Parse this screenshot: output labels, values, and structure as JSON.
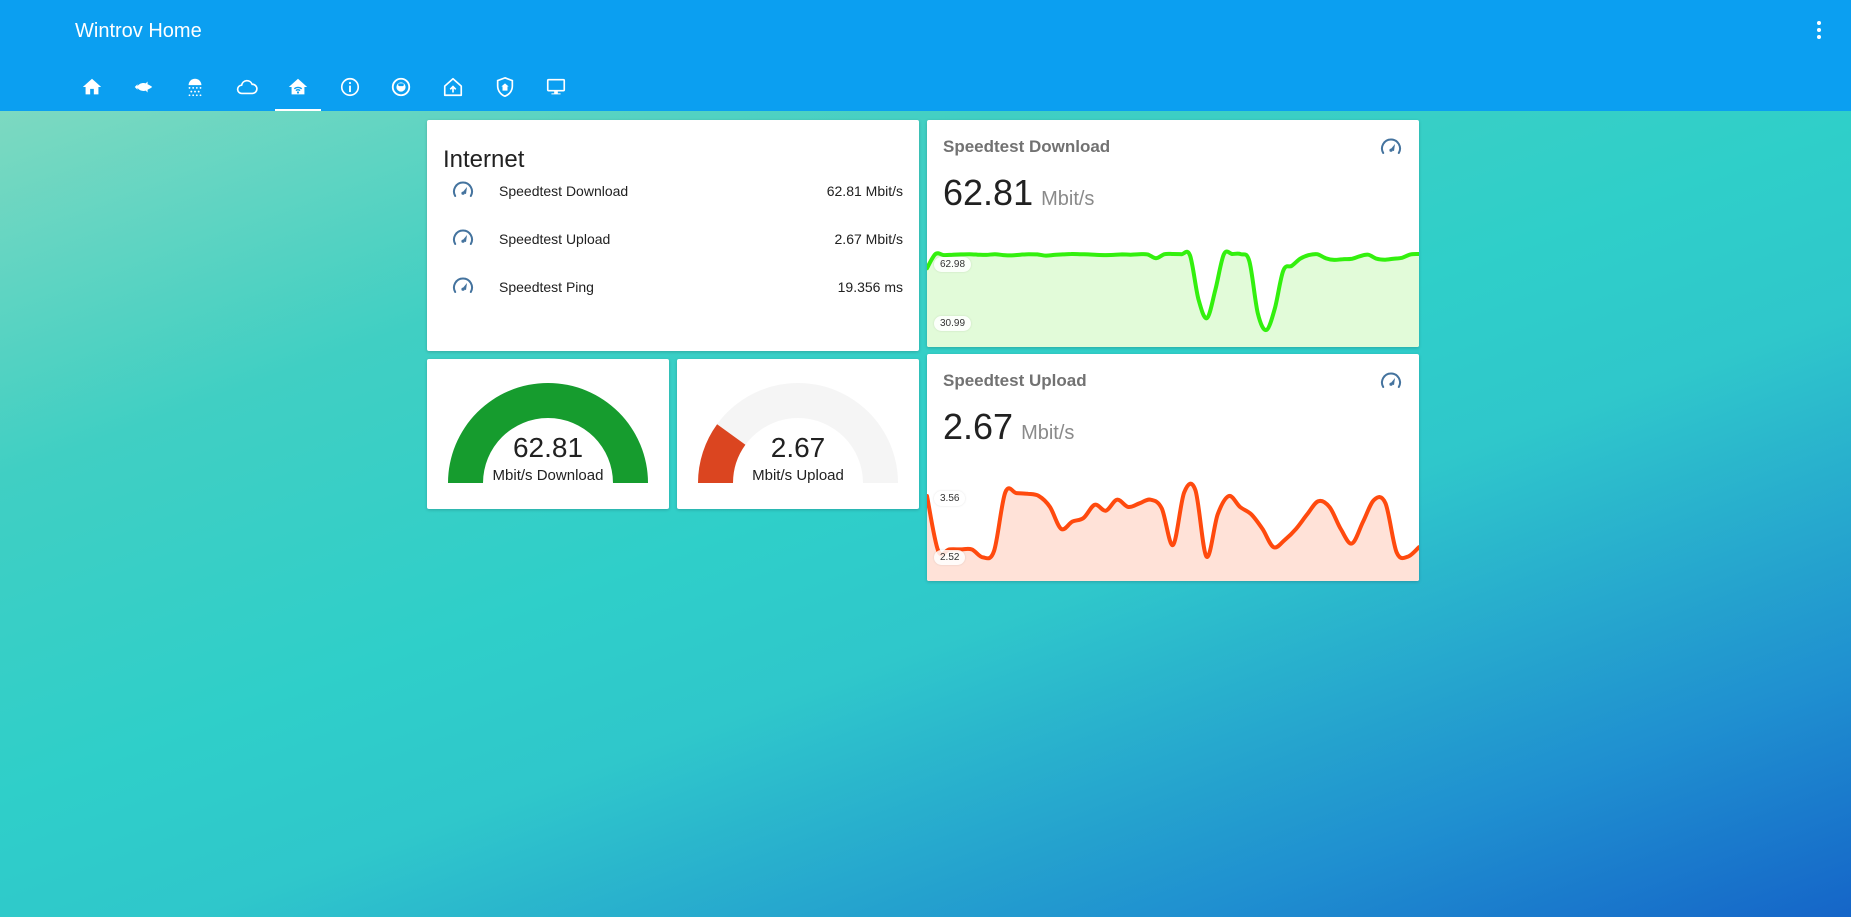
{
  "header": {
    "title": "Wintrov Home",
    "menu_icon": "dots-vertical-icon",
    "tabs": [
      {
        "icon": "home-icon",
        "active": false
      },
      {
        "icon": "fish-icon",
        "active": false
      },
      {
        "icon": "shower-icon",
        "active": false
      },
      {
        "icon": "cloud-icon",
        "active": false
      },
      {
        "icon": "home-wifi-icon",
        "active": true
      },
      {
        "icon": "info-icon",
        "active": false
      },
      {
        "icon": "robot-vacuum-icon",
        "active": false
      },
      {
        "icon": "home-import-icon",
        "active": false
      },
      {
        "icon": "shield-home-icon",
        "active": false
      },
      {
        "icon": "monitor-icon",
        "active": false
      }
    ],
    "colors": {
      "bar": "#0b9ff1",
      "text": "#ffffff"
    }
  },
  "internet_card": {
    "title": "Internet",
    "rows": [
      {
        "icon": "speedometer-icon",
        "name": "Speedtest Download",
        "value": "62.81 Mbit/s"
      },
      {
        "icon": "speedometer-icon",
        "name": "Speedtest Upload",
        "value": "2.67 Mbit/s"
      },
      {
        "icon": "speedometer-icon",
        "name": "Speedtest Ping",
        "value": "19.356 ms"
      }
    ]
  },
  "gauges": [
    {
      "value": "62.81",
      "label": "Mbit/s Download",
      "fraction": 1.0,
      "color": "#169c2e"
    },
    {
      "value": "2.67",
      "label": "Mbit/s Upload",
      "fraction": 0.2,
      "color": "#db4520"
    }
  ],
  "sensors": [
    {
      "name": "Speedtest Download",
      "icon": "speedometer-icon",
      "value": "62.81",
      "unit": "Mbit/s",
      "graph_max_label": "62.98",
      "graph_min_label": "30.99",
      "line_color": "#33f00e",
      "fill_color": "#e2fbd9",
      "min": 30.99,
      "max": 62.98,
      "points": [
        57,
        62.98,
        62.5,
        62.7,
        62.8,
        62.9,
        62.7,
        62.6,
        62.9,
        62.5,
        62.4,
        62.7,
        62.9,
        62.8,
        62.3,
        62.6,
        62.8,
        63,
        62.9,
        62.8,
        62.6,
        62.5,
        62.6,
        62.8,
        62.7,
        62.9,
        62.8,
        61.2,
        62.9,
        63,
        62.9,
        62.4,
        44,
        36,
        48,
        62.9,
        63,
        62.9,
        60,
        38,
        31,
        40,
        56,
        58,
        61,
        62.5,
        62.9,
        61.2,
        60.5,
        60.8,
        60.9,
        62,
        62.7,
        61,
        60.6,
        61,
        61.4,
        62.8,
        63
      ]
    },
    {
      "name": "Speedtest Upload",
      "icon": "speedometer-icon",
      "value": "2.67",
      "unit": "Mbit/s",
      "graph_max_label": "3.56",
      "graph_min_label": "2.52",
      "line_color": "#ff4a0e",
      "fill_color": "#ffe2d8",
      "min": 2.52,
      "max": 3.56,
      "points": [
        3.45,
        2.7,
        2.72,
        2.72,
        2.72,
        2.61,
        2.7,
        3.5,
        3.49,
        3.48,
        3.45,
        3.3,
        3.0,
        3.1,
        3.15,
        3.33,
        3.25,
        3.4,
        3.3,
        3.35,
        3.4,
        3.28,
        2.78,
        3.5,
        3.53,
        2.62,
        3.2,
        3.45,
        3.3,
        3.2,
        3.0,
        2.75,
        2.85,
        3.0,
        3.2,
        3.38,
        3.3,
        3.0,
        2.8,
        3.1,
        3.4,
        3.35,
        2.68,
        2.62,
        2.75
      ]
    }
  ]
}
